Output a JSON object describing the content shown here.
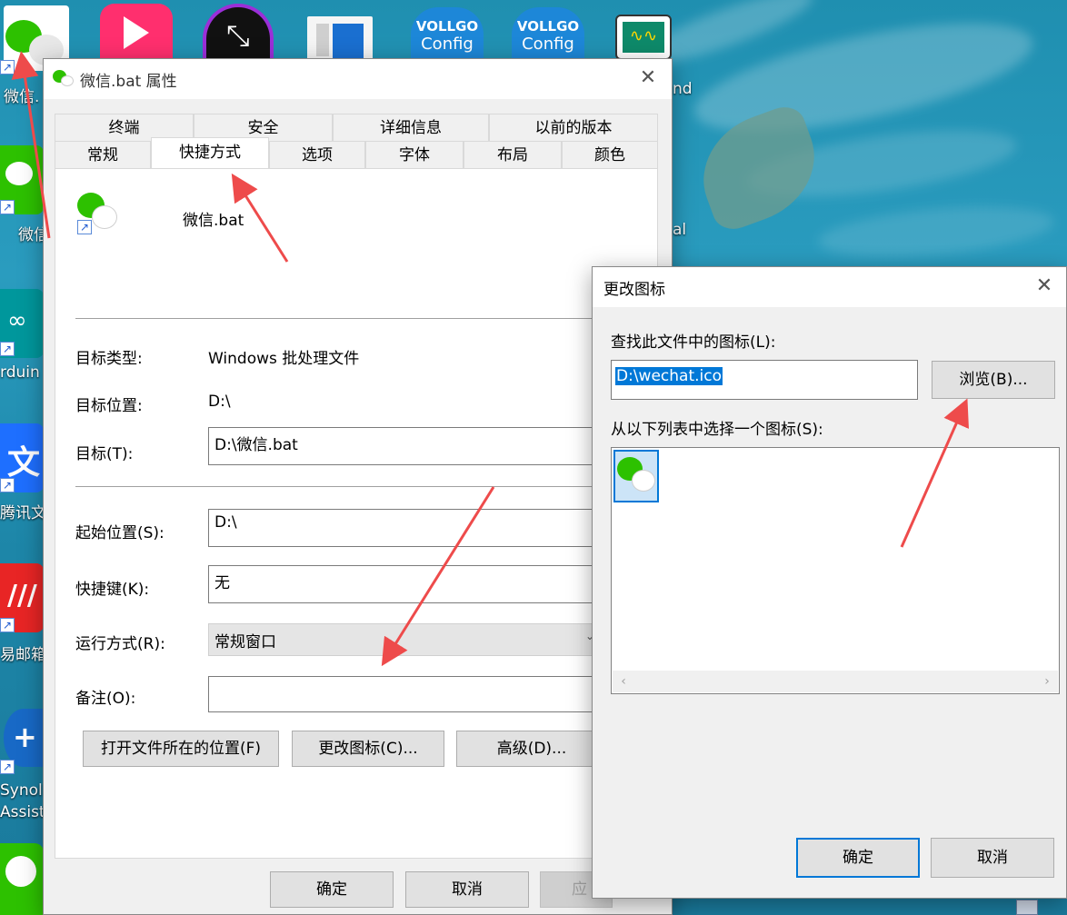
{
  "desktop": {
    "icons": [
      {
        "label": "微信.",
        "name": "wechat-desktop-icon"
      },
      {
        "label": "",
        "name": "pink-app-icon"
      },
      {
        "label": "",
        "name": "shrink-app-icon"
      },
      {
        "label": "",
        "name": "document-app-icon"
      },
      {
        "title": "VOLLGO",
        "sub": "Config",
        "name": "vollgo-config-icon-1"
      },
      {
        "title": "VOLLGO",
        "sub": "Config",
        "name": "vollgo-config-icon-2"
      },
      {
        "label": "",
        "name": "waveform-app-icon"
      },
      {
        "label": "微信",
        "name": "wechat-desktop-icon-2"
      },
      {
        "label": "rduin",
        "name": "arduino-icon"
      },
      {
        "label": "腾讯文",
        "name": "tencent-docs-icon"
      },
      {
        "label": "易邮箱",
        "name": "netease-mail-icon"
      },
      {
        "label": "Synol",
        "label2": "Assist",
        "name": "synology-assistant-icon"
      },
      {
        "label": "nd",
        "name": "partial-label-1"
      },
      {
        "label": "al",
        "name": "partial-label-2"
      }
    ]
  },
  "props": {
    "title": "微信.bat 属性",
    "tabs_top": [
      "终端",
      "安全",
      "详细信息",
      "以前的版本"
    ],
    "tabs_bottom": [
      "常规",
      "快捷方式",
      "选项",
      "字体",
      "布局",
      "颜色"
    ],
    "file_name": "微信.bat",
    "target_type_label": "目标类型:",
    "target_type_value": "Windows 批处理文件",
    "target_location_label": "目标位置:",
    "target_location_value": "D:\\",
    "target_label": "目标(T):",
    "target_value": "D:\\微信.bat",
    "start_in_label": "起始位置(S):",
    "start_in_value": "D:\\",
    "shortcut_key_label": "快捷键(K):",
    "shortcut_key_value": "无",
    "run_label": "运行方式(R):",
    "run_value": "常规窗口",
    "comment_label": "备注(O):",
    "comment_value": "",
    "open_location_button": "打开文件所在的位置(F)",
    "change_icon_button": "更改图标(C)...",
    "advanced_button": "高级(D)...",
    "ok_button": "确定",
    "cancel_button": "取消",
    "apply_button": "应"
  },
  "change_icon": {
    "title": "更改图标",
    "look_label": "查找此文件中的图标(L):",
    "path_value": "D:\\wechat.ico",
    "browse_button": "浏览(B)...",
    "select_label": "从以下列表中选择一个图标(S):",
    "ok_button": "确定",
    "cancel_button": "取消"
  },
  "colors": {
    "accent": "#0078d7",
    "annotation_arrow": "#ee4b4b",
    "wechat_green": "#2dc100"
  }
}
